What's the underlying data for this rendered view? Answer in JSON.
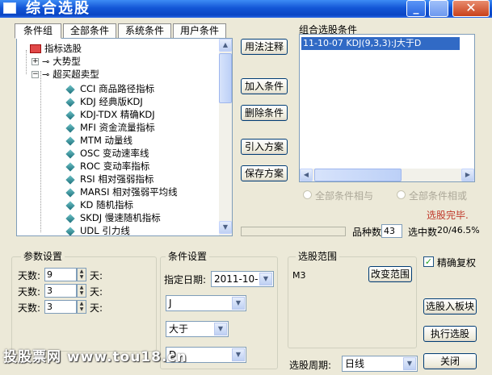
{
  "window": {
    "title": "综合选股",
    "minimize": "_",
    "close": "✕"
  },
  "tabs": [
    "条件组",
    "全部条件",
    "系统条件",
    "用户条件"
  ],
  "tree": {
    "root": "指标选股",
    "groups": [
      {
        "label": "大势型",
        "expander": "+"
      },
      {
        "label": "超买超卖型",
        "expander": "−"
      }
    ],
    "items": [
      "CCI 商品路径指标",
      "KDJ 经典版KDJ",
      "KDJ-TDX 精确KDJ",
      "MFI 资金流量指标",
      "MTM 动量线",
      "OSC 变动速率线",
      "ROC 变动率指标",
      "RSI 相对强弱指标",
      "MARSI 相对强弱平均线",
      "KD 随机指标",
      "SKDJ 慢速随机指标",
      "UDL 引力线"
    ]
  },
  "middle_buttons": {
    "usage": "用法注释",
    "add": "加入条件",
    "remove": "删除条件",
    "import": "引入方案",
    "save": "保存方案"
  },
  "combined": {
    "label": "组合选股条件",
    "items": [
      "11-10-07 KDJ(9,3,3):J大于D"
    ],
    "radio_and": "全部条件相与",
    "radio_or": "全部条件相或",
    "status": "选股完毕.",
    "status_color": "#c0392b",
    "stock_count_label": "品种数",
    "stock_count": "43",
    "selected_label": "选中数",
    "selected_value": "20/46.5%"
  },
  "params": {
    "title": "参数设置",
    "rows": [
      {
        "label": "天数:",
        "value": "9",
        "unit": "天:"
      },
      {
        "label": "天数:",
        "value": "3",
        "unit": "天:"
      },
      {
        "label": "天数:",
        "value": "3",
        "unit": "天:"
      }
    ]
  },
  "condition": {
    "title": "条件设置",
    "date_label": "指定日期:",
    "date_value": "2011-10-",
    "field1": "J",
    "operator": "大于",
    "field2": "D"
  },
  "scope": {
    "title": "选股范围",
    "value": "M3",
    "change_button": "改变范围",
    "period_label": "选股周期:",
    "period_value": "日线"
  },
  "right_controls": {
    "exact_reweight": "精确复权",
    "to_board": "选股入板块",
    "execute": "执行选股",
    "close": "关闭"
  },
  "watermark": "投股票网 www.tou18.cn"
}
